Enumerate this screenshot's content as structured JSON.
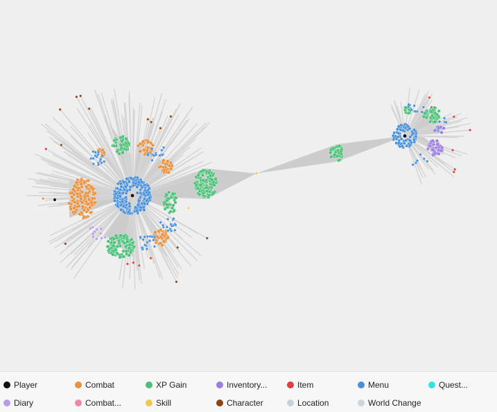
{
  "legend": {
    "items": [
      {
        "label": "Player",
        "color": "#111111"
      },
      {
        "label": "Combat",
        "color": "#e8913f"
      },
      {
        "label": "XP Gain",
        "color": "#4cbf78"
      },
      {
        "label": "Inventory...",
        "color": "#9c7ee0"
      },
      {
        "label": "Item",
        "color": "#e23e3e"
      },
      {
        "label": "Menu",
        "color": "#4a90d9"
      },
      {
        "label": "Quest...",
        "color": "#33e3e3"
      },
      {
        "label": "Diary",
        "color": "#b59be8"
      },
      {
        "label": "Combat...",
        "color": "#ee88aa"
      },
      {
        "label": "Skill",
        "color": "#f0c850"
      },
      {
        "label": "Character",
        "color": "#8b4513"
      },
      {
        "label": "Location",
        "color": "#c9d2db"
      },
      {
        "label": "World Change",
        "color": "#cdd6df"
      }
    ]
  }
}
